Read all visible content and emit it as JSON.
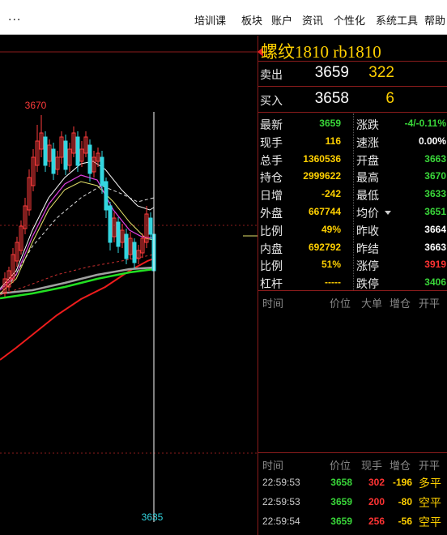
{
  "menu": {
    "more_label": "...",
    "items": [
      "培训课",
      "板块",
      "账户",
      "资讯",
      "个性化",
      "系统工具",
      "帮助"
    ]
  },
  "chart": {
    "high_label": "3670",
    "low_label": "3635",
    "colors": {
      "candle_up": "#ff3b3b",
      "candle_down": "#33d6e0",
      "ma_white": "#ffffff",
      "ma_yellow": "#e5e26a",
      "ma_magenta": "#e040e0",
      "ma_green": "#22e022",
      "ma_gray": "#a0a0a0",
      "ma_red": "#ee1c1c",
      "grid": "#8b1c1c",
      "cursor": "#ffffff"
    }
  },
  "instrument": {
    "title": "螺纹1810  rb1810"
  },
  "order_book": {
    "ask": {
      "label": "卖出",
      "price": "3659",
      "volume": "322"
    },
    "bid": {
      "label": "买入",
      "price": "3658",
      "volume": "6"
    }
  },
  "stats": [
    {
      "label": "最新",
      "value": "3659",
      "value_color": "#39d639",
      "label2": "涨跌",
      "value2": "-4/-0.11%",
      "value2_color": "#39d639"
    },
    {
      "label": "现手",
      "value": "116",
      "value_color": "#ffd000",
      "label2": "速涨",
      "value2": "0.00%",
      "value2_color": "#ffffff"
    },
    {
      "label": "总手",
      "value": "1360536",
      "value_color": "#ffd000",
      "label2": "开盘",
      "value2": "3663",
      "value2_color": "#39d639"
    },
    {
      "label": "持仓",
      "value": "2999622",
      "value_color": "#ffd000",
      "label2": "最高",
      "value2": "3670",
      "value2_color": "#39d639"
    },
    {
      "label": "日增",
      "value": "-242",
      "value_color": "#ffd000",
      "label2": "最低",
      "value2": "3633",
      "value2_color": "#39d639"
    },
    {
      "label": "外盘",
      "value": "667744",
      "value_color": "#ffd000",
      "label2": "均价",
      "value2": "3651",
      "value2_color": "#39d639"
    },
    {
      "label": "比例",
      "value": "49%",
      "value_color": "#ffd000",
      "label2": "昨收",
      "value2": "3664",
      "value2_color": "#ffffff"
    },
    {
      "label": "内盘",
      "value": "692792",
      "value_color": "#ffd000",
      "label2": "昨结",
      "value2": "3663",
      "value2_color": "#ffffff"
    },
    {
      "label": "比例",
      "value": "51%",
      "value_color": "#ffd000",
      "label2": "涨停",
      "value2": "3919",
      "value2_color": "#ff3333"
    },
    {
      "label": "杠杆",
      "value": "-----",
      "value_color": "#ffd000",
      "label2": "跌停",
      "value2": "3406",
      "value2_color": "#39d639"
    }
  ],
  "big_orders": {
    "headers": [
      "时间",
      "价位",
      "大单",
      "增仓",
      "开平"
    ]
  },
  "ticks": {
    "headers": [
      "时间",
      "价位",
      "现手",
      "增仓",
      "开平"
    ],
    "rows": [
      {
        "time": "22:59:53",
        "price": "3658",
        "qty": "302",
        "delta": "-196",
        "kind": "多平"
      },
      {
        "time": "22:59:53",
        "price": "3659",
        "qty": "200",
        "delta": "-80",
        "kind": "空平"
      },
      {
        "time": "22:59:54",
        "price": "3659",
        "qty": "256",
        "delta": "-56",
        "kind": "空平"
      }
    ]
  }
}
